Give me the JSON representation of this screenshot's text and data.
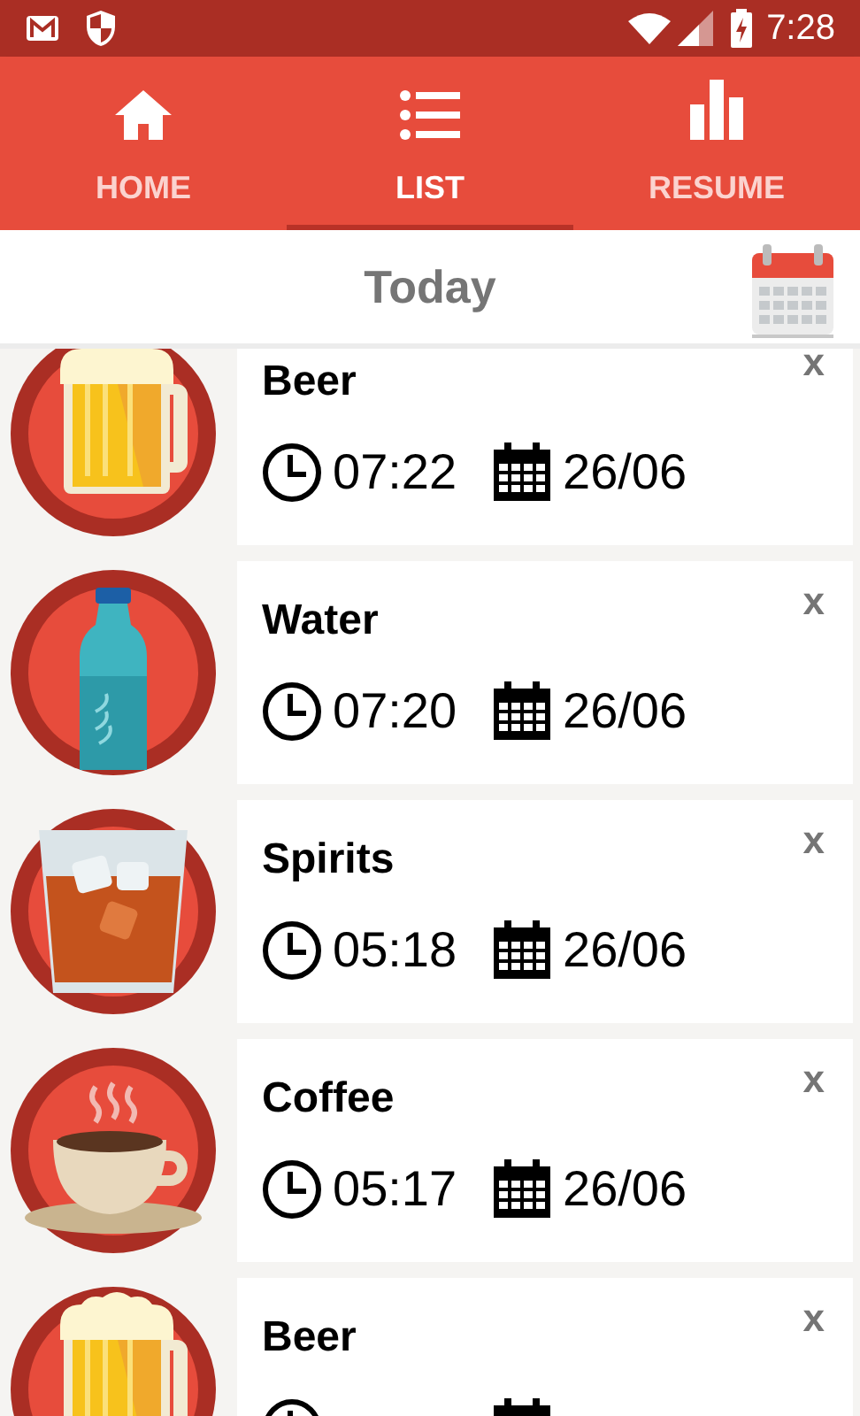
{
  "status_bar": {
    "time": "7:28"
  },
  "tabs": [
    {
      "label": "HOME",
      "kind": "home",
      "selected": false
    },
    {
      "label": "LIST",
      "kind": "list",
      "selected": true
    },
    {
      "label": "RESUME",
      "kind": "chart",
      "selected": false
    }
  ],
  "header": {
    "title": "Today"
  },
  "entries": [
    {
      "kind": "beer",
      "name": "Beer",
      "time": "07:22",
      "date": "26/06",
      "delete": "x"
    },
    {
      "kind": "water",
      "name": "Water",
      "time": "07:20",
      "date": "26/06",
      "delete": "x"
    },
    {
      "kind": "spirits",
      "name": "Spirits",
      "time": "05:18",
      "date": "26/06",
      "delete": "x"
    },
    {
      "kind": "coffee",
      "name": "Coffee",
      "time": "05:17",
      "date": "26/06",
      "delete": "x"
    },
    {
      "kind": "beer",
      "name": "Beer",
      "delete": "x"
    }
  ]
}
